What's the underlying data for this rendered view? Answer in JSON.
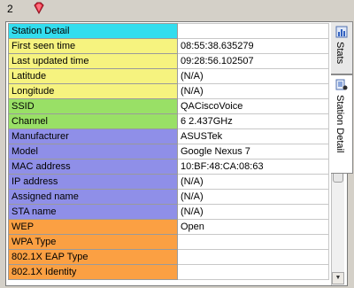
{
  "toolbar": {
    "count": "2",
    "icon": "gem-icon"
  },
  "side_tabs": [
    {
      "label": "Stats",
      "icon": "stats-icon"
    },
    {
      "label": "Station Detail",
      "icon": "station-icon"
    }
  ],
  "rows": [
    {
      "label": "Station Detail",
      "value": "",
      "color": "#33ddee"
    },
    {
      "label": "First seen time",
      "value": "08:55:38.635279",
      "color": "#f6f37f"
    },
    {
      "label": "Last updated time",
      "value": "09:28:56.102507",
      "color": "#f6f37f"
    },
    {
      "label": "Latitude",
      "value": "(N/A)",
      "color": "#f6f37f"
    },
    {
      "label": "Longitude",
      "value": "(N/A)",
      "color": "#f6f37f"
    },
    {
      "label": "SSID",
      "value": "QACiscoVoice",
      "color": "#99e066"
    },
    {
      "label": "Channel",
      "value": "6 2.437GHz",
      "color": "#99e066"
    },
    {
      "label": "Manufacturer",
      "value": "ASUSTek",
      "color": "#8f8fe8"
    },
    {
      "label": "Model",
      "value": "Google Nexus 7",
      "color": "#8f8fe8"
    },
    {
      "label": "MAC address",
      "value": "10:BF:48:CA:08:63",
      "color": "#8f8fe8"
    },
    {
      "label": "IP address",
      "value": "(N/A)",
      "color": "#8f8fe8"
    },
    {
      "label": "Assigned name",
      "value": "(N/A)",
      "color": "#8f8fe8"
    },
    {
      "label": "STA name",
      "value": "(N/A)",
      "color": "#8f8fe8"
    },
    {
      "label": "WEP",
      "value": "Open",
      "color": "#fba043"
    },
    {
      "label": "WPA Type",
      "value": "",
      "color": "#fba043"
    },
    {
      "label": "802.1X EAP Type",
      "value": "",
      "color": "#fba043"
    },
    {
      "label": "802.1X Identity",
      "value": "",
      "color": "#fba043"
    }
  ]
}
